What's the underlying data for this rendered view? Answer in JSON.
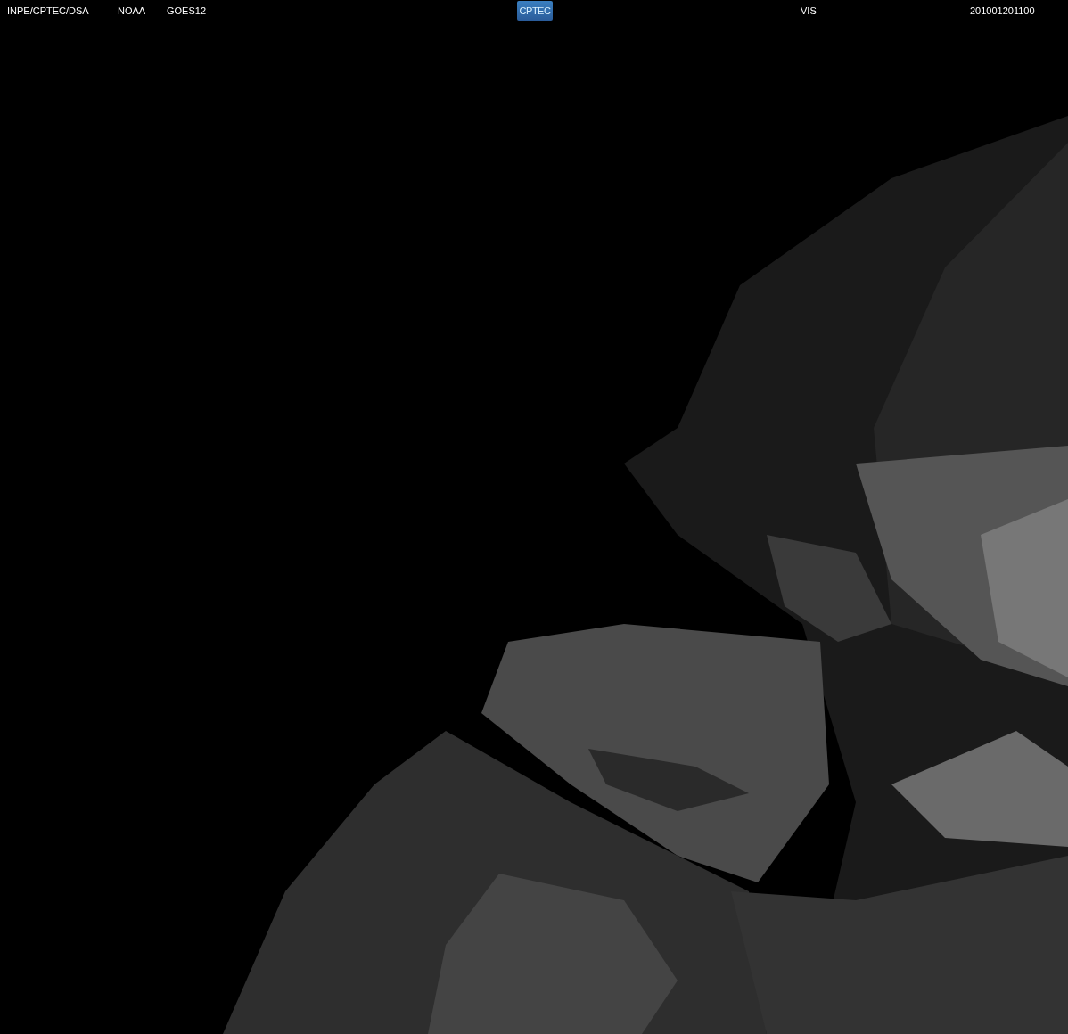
{
  "header": {
    "source": "INPE/CPTEC/DSA",
    "agency": "NOAA",
    "satellite": "GOES12",
    "logo": "CPTEC",
    "channel": "VIS",
    "timestamp": "201001201100"
  }
}
